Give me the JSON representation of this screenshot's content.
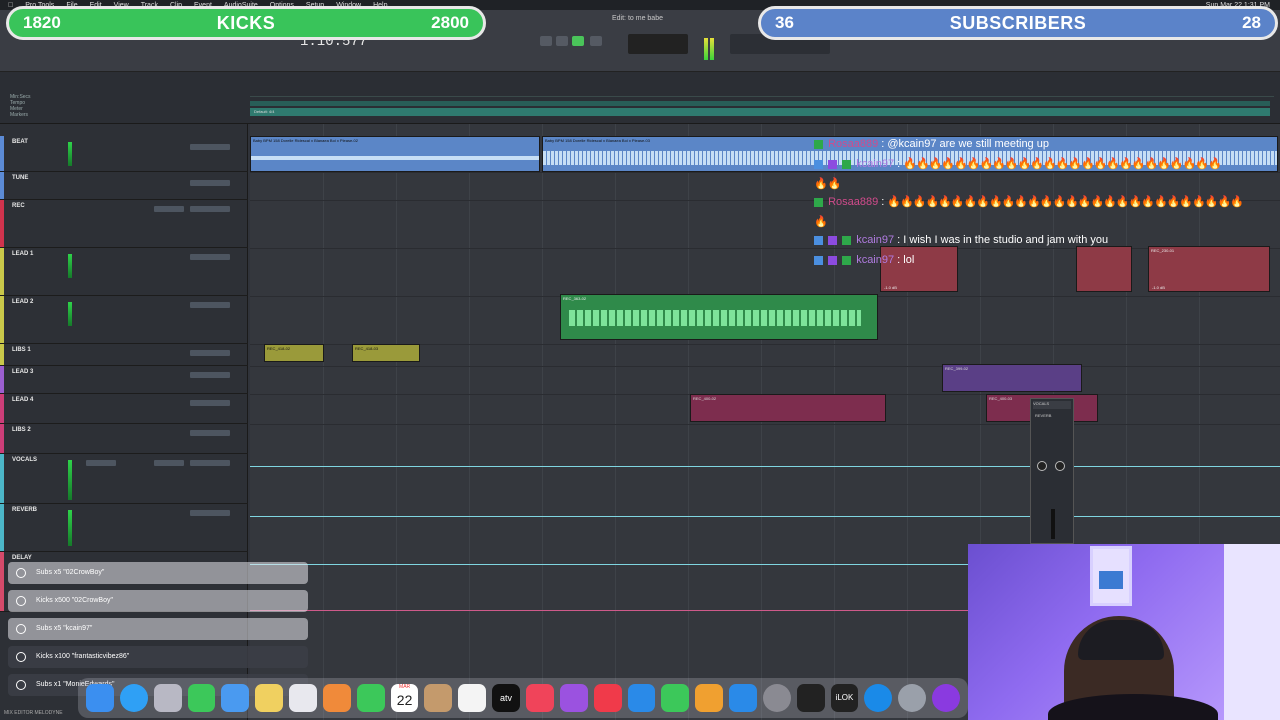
{
  "menubar": {
    "items": [
      "Pro Tools",
      "File",
      "Edit",
      "View",
      "Track",
      "Clip",
      "Event",
      "AudioSuite",
      "Options",
      "Setup",
      "Window",
      "Help"
    ],
    "clock": "Sun Mar 22 1:31 PM"
  },
  "toolbar": {
    "counter": "1:10.577",
    "doc_title": "Edit: to me babe"
  },
  "banners": {
    "left": {
      "count_left": "1820",
      "title": "KICKS",
      "count_right": "2800"
    },
    "right": {
      "count_left": "36",
      "title": "SUBSCRIBERS",
      "count_right": "28"
    }
  },
  "ruler_rows": [
    "Min:Secs",
    "Tempo",
    "Meter",
    "Markers"
  ],
  "marker_label": "Default: 4/4",
  "tracks": [
    {
      "name": "BEAT",
      "color": "#5c8bd6"
    },
    {
      "name": "TUNE",
      "color": "#5c8bd6"
    },
    {
      "name": "REC",
      "color": "#d0334d"
    },
    {
      "name": "LEAD 1",
      "color": "#c9c84a"
    },
    {
      "name": "LEAD 2",
      "color": "#c9c84a"
    },
    {
      "name": "LIBS 1",
      "color": "#c9c84a"
    },
    {
      "name": "LEAD 3",
      "color": "#9b5fd0"
    },
    {
      "name": "LEAD 4",
      "color": "#cc3e78"
    },
    {
      "name": "LIBS 2",
      "color": "#cc3e78"
    },
    {
      "name": "VOCALS",
      "color": "#4cb6c8"
    },
    {
      "name": "REVERB",
      "color": "#4cb6c8"
    },
    {
      "name": "DELAY",
      "color": "#d44a6a"
    }
  ],
  "clips": {
    "beat": "Baby BPM 158 Dorelle Ridescal x Blanaea Boi x Please-02",
    "beat2": "Baby BPM 158 Dorelle Ridescal x Blanaea Boi x Please-03",
    "lead2": "REC_363-02",
    "libs1a": "REC_418-02",
    "libs1b": "REC_418-03",
    "lead1a": "REC_230-01",
    "lead4": "REC_400-02",
    "lead3": "REC_399-02",
    "lead3b": "REC_396-02",
    "libs2": "REC_400-03",
    "gain": "-1.0 dB"
  },
  "chat": [
    {
      "user": "Rosaa889",
      "text": "@kcain97 are we still meeting up",
      "style": "pink"
    },
    {
      "user": "kcain97",
      "text": "🔥🔥🔥🔥🔥🔥🔥🔥🔥🔥🔥🔥🔥🔥🔥🔥🔥🔥🔥🔥🔥🔥🔥🔥🔥",
      "style": "purple",
      "wrap": "🔥🔥"
    },
    {
      "user": "Rosaa889",
      "text": "🔥🔥🔥🔥🔥🔥🔥🔥🔥🔥🔥🔥🔥🔥🔥🔥🔥🔥🔥🔥🔥🔥🔥🔥🔥🔥🔥🔥",
      "style": "pink",
      "wrap": "🔥"
    },
    {
      "user": "kcain97",
      "text": "I wish I was in the studio and jam with you",
      "style": "purple"
    },
    {
      "user": "kcain97",
      "text": "lol",
      "style": "purple"
    }
  ],
  "minimix": {
    "title": "VOCALS",
    "plugin": "REVERB"
  },
  "alerts": [
    {
      "text": "Subs x5 \"02CrowBoy\"",
      "dark": false
    },
    {
      "text": "Kicks x500 \"02CrowBoy\"",
      "dark": false
    },
    {
      "text": "Subs x5 \"kcain97\"",
      "dark": false
    },
    {
      "text": "Kicks x100 \"frantasticvibez86\"",
      "dark": true
    },
    {
      "text": "Subs x1 \"MonieEdwards\"",
      "dark": true
    }
  ],
  "dock": {
    "apps": [
      "finder",
      "safari",
      "launchpad",
      "messages",
      "mail",
      "files",
      "photos",
      "photos-app",
      "facetime",
      "calendar",
      "contacts",
      "reminders",
      "apple-tv",
      "music",
      "podcasts",
      "news",
      "keynote",
      "numbers",
      "pages",
      "app-store",
      "system-settings",
      "logic",
      "ilok",
      "circle-app",
      "pro-tools",
      "twitch"
    ],
    "calendar_day": "22",
    "calendar_month": "MAR",
    "tv_label": "atv",
    "ilok_label": "iLOK"
  },
  "bottom_left": "MIX  EDITOR  MELODYNE"
}
